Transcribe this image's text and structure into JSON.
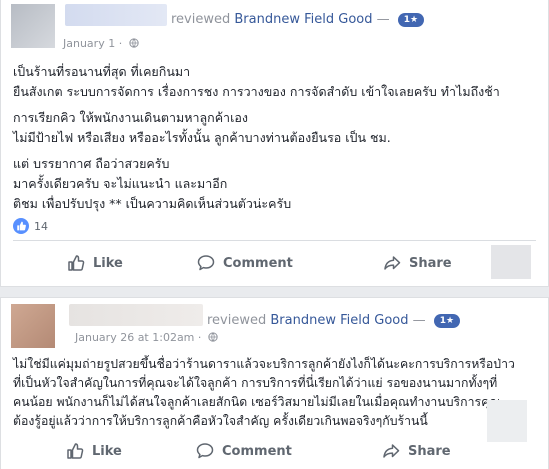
{
  "reviews": [
    {
      "reviewed_text": "reviewed",
      "page_name": "Brandnew Field Good",
      "separator": "—",
      "rating": "1★",
      "date": "January 1 ·",
      "body": [
        "เป็นร้านที่รอนานที่สุด ที่เคยกินมา",
        "ยืนสังเกต ระบบการจัดการ เรื่องการชง การวางของ การจัดสำดับ เข้าใจเลยครับ ทำไมถึงช้า",
        "",
        "การเรียกคิว ให้พนักงานเดินตามหาลูกค้าเอง",
        "ไม่มีป้ายไฟ หรือเสียง หรืออะไรทั้งนั้น ลูกค้าบางท่านต้องยืนรอ เป็น ชม.",
        "",
        "แต่ บรรยากาศ ถือว่าสวยครับ",
        "มาครั้งเดียวครับ จะไม่แนะนำ และมาอีก",
        "ติชม เพื่อปรับปรุง ** เป็นความคิดเห็นส่วนตัวน่ะครับ"
      ],
      "reaction_count": "14"
    },
    {
      "reviewed_text": "reviewed",
      "page_name": "Brandnew Field Good",
      "separator": "—",
      "rating": "1★",
      "date": "January 26 at 1:02am ·",
      "body": [
        "ไม่ใช่มีแค่มุมถ่ายรูปสวยขึ้นชื่อว่าร้านดาราแล้วจะบริการลูกค้ายังไงก็ได้นะคะการบริการหรือป่าว",
        "ที่เป็นหัวใจสำคัญในการที่คุณจะได้ใจลูกค้า การบริการที่นี่เรียกได้ว่าแย่ รอของนานมากทั้งๆที่",
        "คนน้อย พนักงานก็ไม่ได้สนใจลูกค้าเลยสักนิด เซอร์วิสมายไม่มีเลยในเมื่อคุณทำงานบริการคุณ",
        "ต้องรู้อยู่แล้วว่าการให้บริการลูกค้าคือหัวใจสำคัญ ครั้งเดียวเกินพอจริงๆกับร้านนี้"
      ]
    }
  ],
  "actions": {
    "like": "Like",
    "comment": "Comment",
    "share": "Share"
  },
  "colors": {
    "link": "#365899",
    "rating_badge": "#4267b2",
    "meta": "#90949c",
    "background": "#e9ebee"
  },
  "icons": [
    "thumbs-up-icon",
    "comment-icon",
    "share-icon",
    "globe-icon",
    "like-reaction-icon"
  ]
}
